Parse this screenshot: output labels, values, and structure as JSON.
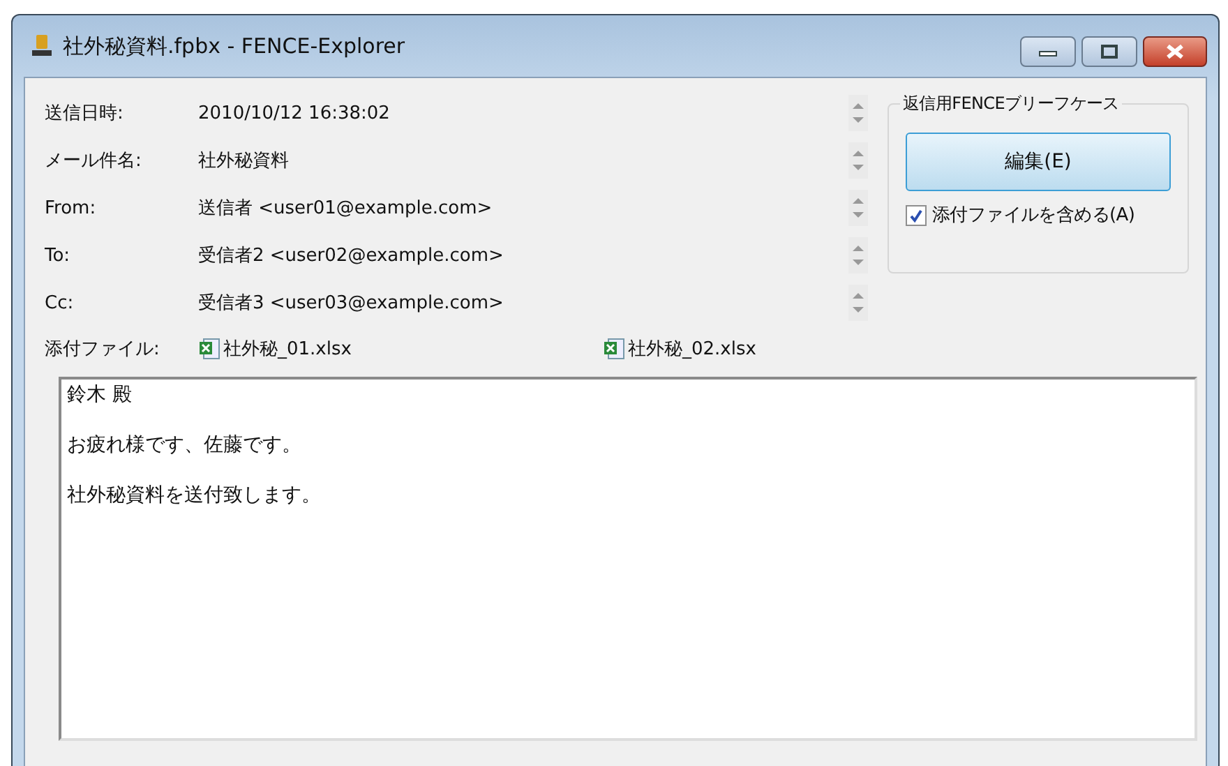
{
  "window": {
    "title": "社外秘資料.fpbx - FENCE-Explorer"
  },
  "headers": [
    {
      "label": "送信日時:",
      "value": "2010/10/12 16:38:02"
    },
    {
      "label": "メール件名:",
      "value": "社外秘資料"
    },
    {
      "label": "From:",
      "value": "送信者 <user01@example.com>"
    },
    {
      "label": "To:",
      "value": "受信者2 <user02@example.com>"
    },
    {
      "label": "Cc:",
      "value": "受信者3 <user03@example.com>"
    }
  ],
  "attachments": {
    "label": "添付ファイル:",
    "files": [
      "社外秘_01.xlsx",
      "社外秘_02.xlsx"
    ]
  },
  "reply_group": {
    "title": "返信用FENCEブリーフケース",
    "button": "編集(E)",
    "include_attachments": {
      "label": "添付ファイルを含める(A)",
      "checked": true
    }
  },
  "body": [
    "鈴木 殿",
    "お疲れ様です、佐藤です。",
    "社外秘資料を送付致します。"
  ]
}
